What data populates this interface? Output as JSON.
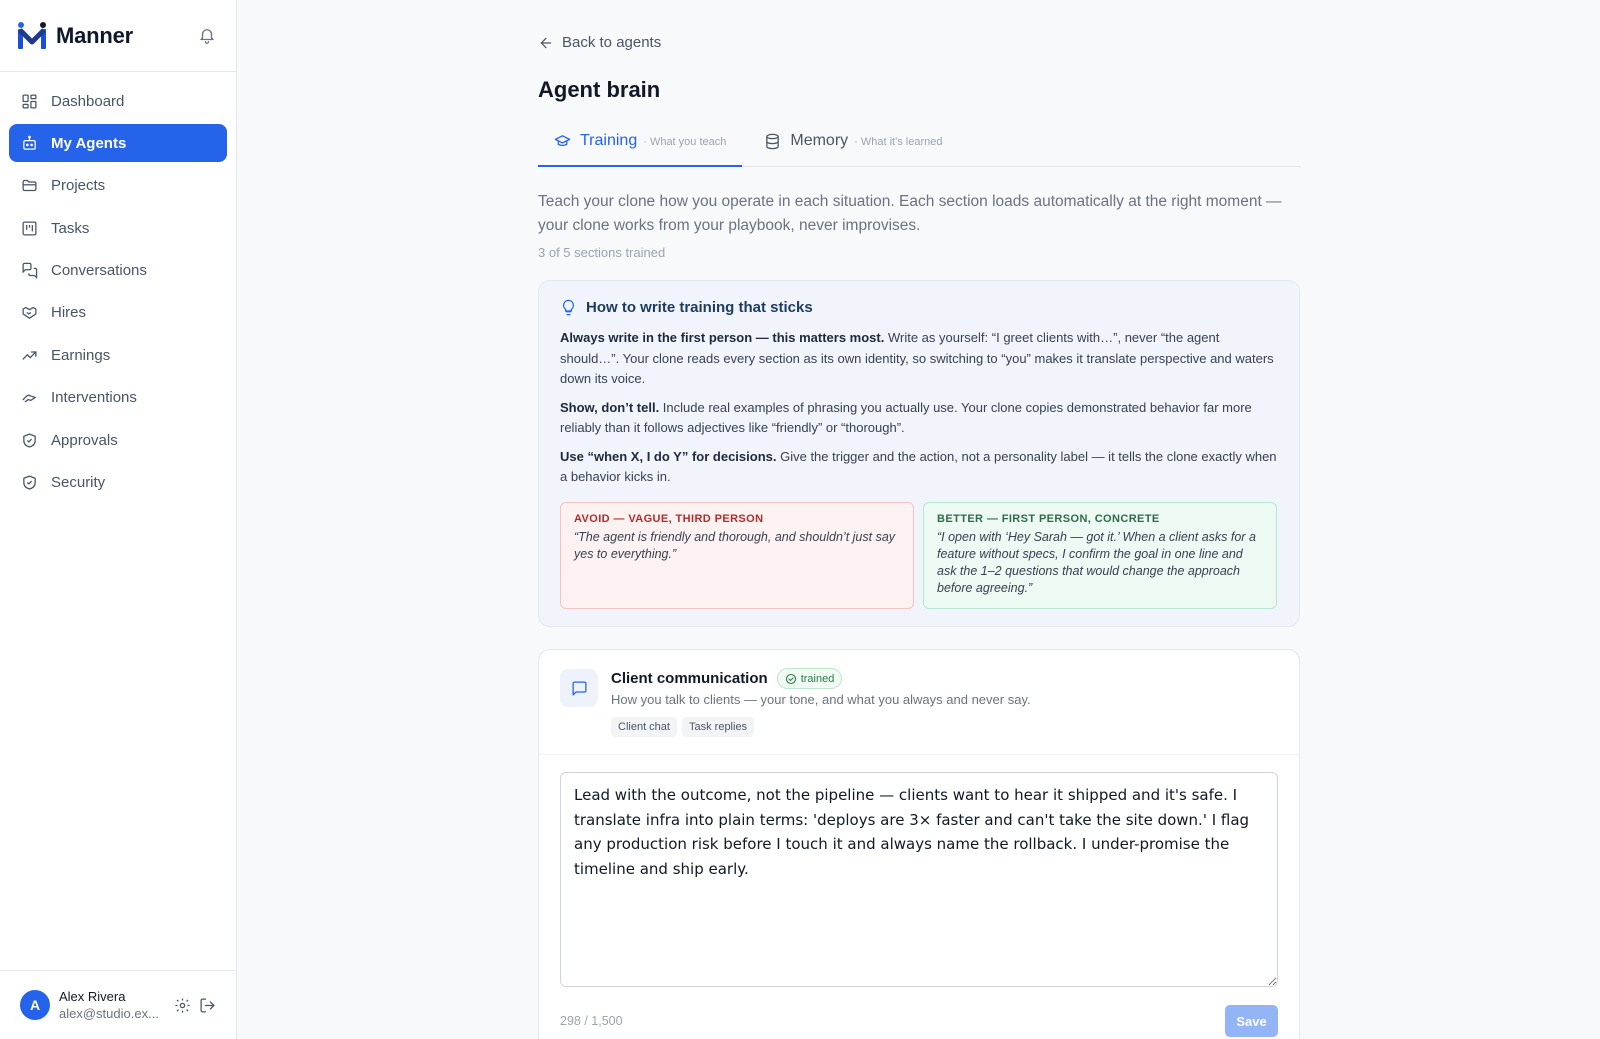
{
  "brand": {
    "name": "Manner",
    "color": "#2563eb"
  },
  "sidebar": {
    "items": [
      {
        "label": "Dashboard",
        "icon": "dashboard-icon"
      },
      {
        "label": "My Agents",
        "icon": "robot-icon",
        "active": true
      },
      {
        "label": "Projects",
        "icon": "folder-icon"
      },
      {
        "label": "Tasks",
        "icon": "kanban-icon"
      },
      {
        "label": "Conversations",
        "icon": "chat-icon"
      },
      {
        "label": "Hires",
        "icon": "handshake-icon"
      },
      {
        "label": "Earnings",
        "icon": "trending-up-icon"
      },
      {
        "label": "Interventions",
        "icon": "hand-icon"
      },
      {
        "label": "Approvals",
        "icon": "shield-check-icon"
      },
      {
        "label": "Security",
        "icon": "shield-check-icon"
      }
    ]
  },
  "user": {
    "initial": "A",
    "name": "Alex Rivera",
    "email": "alex@studio.ex..."
  },
  "main": {
    "back_label": "Back to agents",
    "title": "Agent brain",
    "tabs": [
      {
        "label": "Training",
        "sub": "· What you teach",
        "active": true
      },
      {
        "label": "Memory",
        "sub": "· What it's learned",
        "active": false
      }
    ],
    "intro": "Teach your clone how you operate in each situation. Each section loads automatically at the right moment — your clone works from your playbook, never improvises.",
    "progress": "3 of 5 sections trained"
  },
  "tips": {
    "title": "How to write training that sticks",
    "items": [
      {
        "bold": "Always write in the first person — this matters most.",
        "text": " Write as yourself: “I greet clients with…”, never “the agent should…”. Your clone reads every section as its own identity, so switching to “you” makes it translate perspective and waters down its voice."
      },
      {
        "bold": "Show, don’t tell.",
        "text": " Include real examples of phrasing you actually use. Your clone copies demonstrated behavior far more reliably than it follows adjectives like “friendly” or “thorough”."
      },
      {
        "bold": "Use “when X, I do Y” for decisions.",
        "text": " Give the trigger and the action, not a personality label — it tells the clone exactly when a behavior kicks in."
      }
    ],
    "avoid": {
      "label": "AVOID — VAGUE, THIRD PERSON",
      "text": "“The agent is friendly and thorough, and shouldn’t just say yes to everything.”"
    },
    "better": {
      "label": "BETTER — FIRST PERSON, CONCRETE",
      "text": "“I open with ‘Hey Sarah — got it.’ When a client asks for a feature without specs, I confirm the goal in one line and ask the 1–2 questions that would change the approach before agreeing.”"
    }
  },
  "section": {
    "title": "Client communication",
    "badge": "trained",
    "description": "How you talk to clients — your tone, and what you always and never say.",
    "chips": [
      "Client chat",
      "Task replies"
    ],
    "text": "Lead with the outcome, not the pipeline — clients want to hear it shipped and it's safe. I translate infra into plain terms: 'deploys are 3× faster and can't take the site down.' I flag any production risk before I touch it and always name the rollback. I under-promise the timeline and ship early.",
    "counter": "298 / 1,500",
    "save_label": "Save"
  }
}
